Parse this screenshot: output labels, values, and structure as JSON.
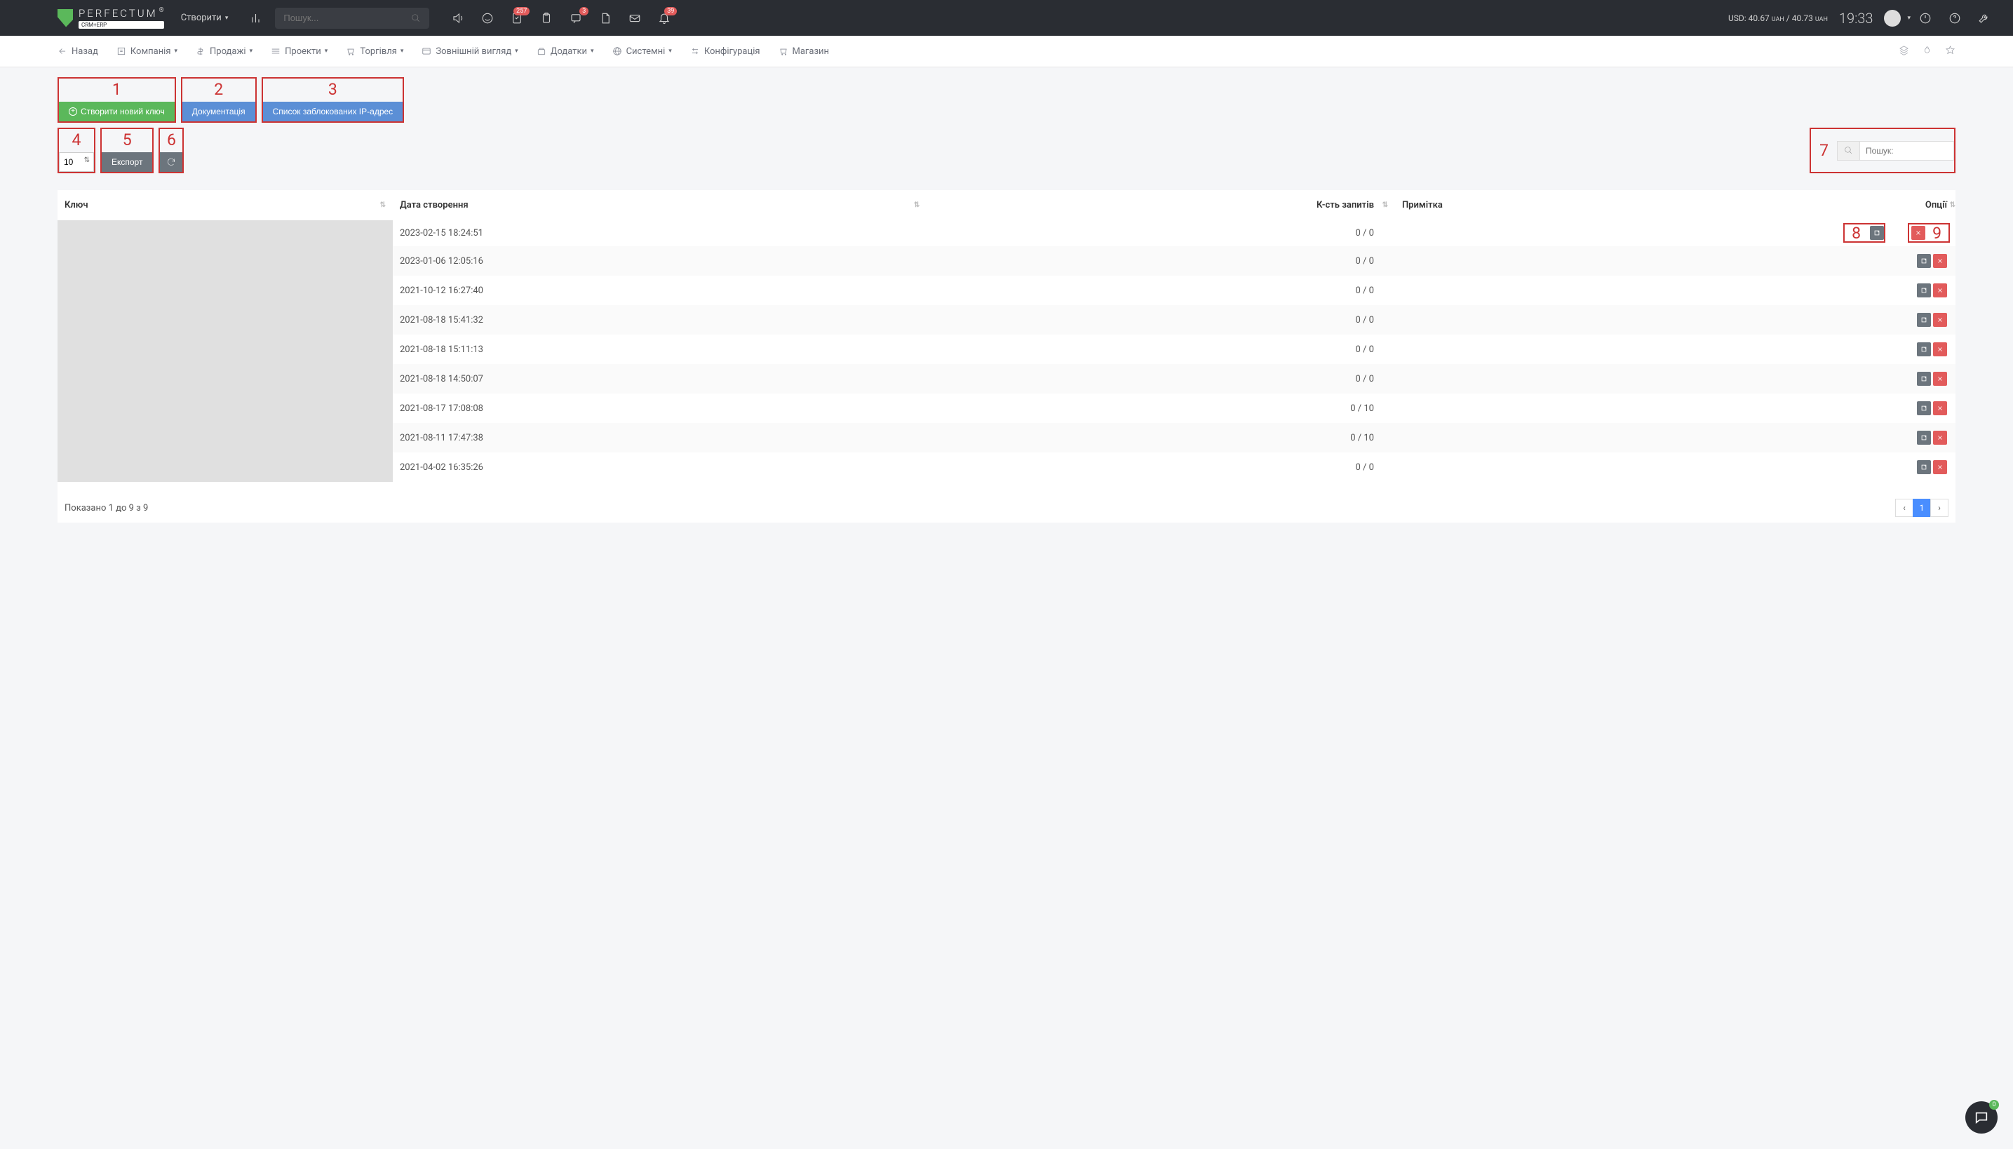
{
  "header": {
    "logo_text": "PERFECTUM",
    "logo_sub": "CRM+ERP",
    "create_label": "Створити",
    "search_placeholder": "Пошук...",
    "badges": {
      "tasks": "257",
      "chat": "3",
      "bell": "39"
    },
    "currency_1_val": "USD: 40.67",
    "currency_1_unit": "UAH",
    "currency_sep": " / ",
    "currency_2_val": "40.73",
    "currency_2_unit": "UAH",
    "clock": "19:33"
  },
  "nav": {
    "back": "Назад",
    "items": [
      "Компанія",
      "Продажі",
      "Проекти",
      "Торгівля",
      "Зовнішній вигляд",
      "Додатки",
      "Системні",
      "Конфігурація",
      "Магазин"
    ]
  },
  "toolbar": {
    "create_key": "Створити новий ключ",
    "docs": "Документація",
    "blocked_ips": "Список заблокованих IP-адрес",
    "page_size": "10",
    "export": "Експорт",
    "search_label": "Пошук:"
  },
  "annotations": [
    "1",
    "2",
    "3",
    "4",
    "5",
    "6",
    "7",
    "8",
    "9"
  ],
  "table": {
    "columns": [
      "Ключ",
      "Дата створення",
      "К-сть запитів",
      "Примітка",
      "Опції"
    ],
    "rows": [
      {
        "date": "2023-02-15 18:24:51",
        "req": "0 / 0"
      },
      {
        "date": "2023-01-06 12:05:16",
        "req": "0 / 0"
      },
      {
        "date": "2021-10-12 16:27:40",
        "req": "0 / 0"
      },
      {
        "date": "2021-08-18 15:41:32",
        "req": "0 / 0"
      },
      {
        "date": "2021-08-18 15:11:13",
        "req": "0 / 0"
      },
      {
        "date": "2021-08-18 14:50:07",
        "req": "0 / 0"
      },
      {
        "date": "2021-08-17 17:08:08",
        "req": "0 / 10"
      },
      {
        "date": "2021-08-11 17:47:38",
        "req": "0 / 10"
      },
      {
        "date": "2021-04-02 16:35:26",
        "req": "0 / 0"
      }
    ]
  },
  "footer": {
    "info": "Показано 1 до 9 з 9",
    "page": "1"
  },
  "chat_badge": "0"
}
